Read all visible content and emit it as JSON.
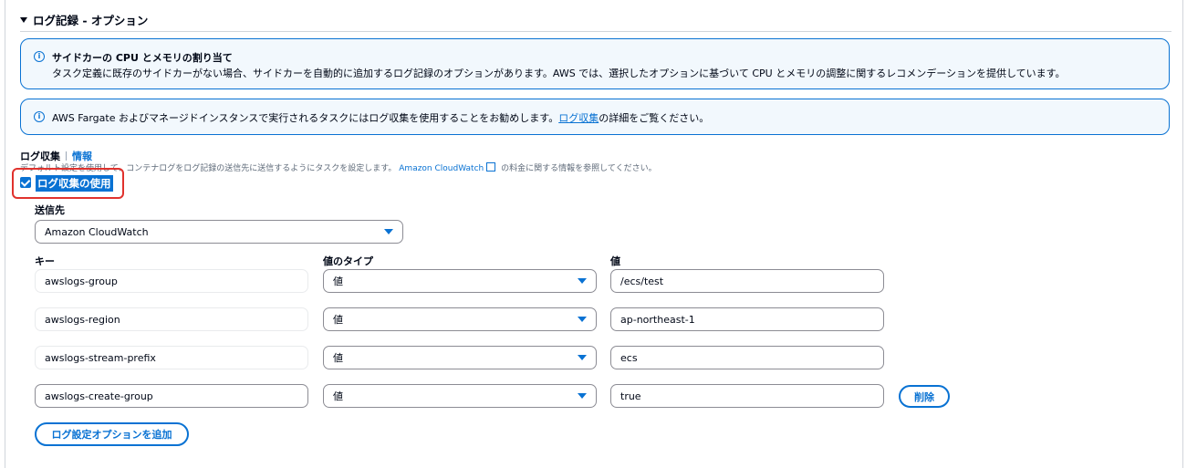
{
  "section": {
    "title": "ログ記録 - オプション"
  },
  "alert_sidecar": {
    "title": "サイドカーの CPU とメモリの割り当て",
    "body": "タスク定義に既存のサイドカーがない場合、サイドカーを自動的に追加するログ記録のオプションがあります。AWS では、選択したオプションに基づいて CPU とメモリの調整に関するレコメンデーションを提供しています。"
  },
  "alert_fargate": {
    "body_before": "AWS Fargate およびマネージドインスタンスで実行されるタスクにはログ収集を使用することをお勧めします。",
    "link": "ログ収集",
    "body_after": "の詳細をご覧ください。"
  },
  "log_collection": {
    "label": "ログ収集",
    "info": "情報",
    "desc_before": "デフォルト設定を使用して、コンテナログをログ記録の送信先に送信するようにタスクを設定します。",
    "desc_link": "Amazon CloudWatch",
    "desc_after": "の料金に関する情報を参照してください。",
    "checkbox_label": "ログ収集の使用",
    "checkbox_checked": true
  },
  "destination": {
    "label": "送信先",
    "value": "Amazon CloudWatch"
  },
  "columns": {
    "key": "キー",
    "value_type": "値のタイプ",
    "value": "値"
  },
  "options": [
    {
      "key": "awslogs-group",
      "type": "値",
      "value": "/ecs/test"
    },
    {
      "key": "awslogs-region",
      "type": "値",
      "value": "ap-northeast-1"
    },
    {
      "key": "awslogs-stream-prefix",
      "type": "値",
      "value": "ecs"
    },
    {
      "key": "awslogs-create-group",
      "type": "値",
      "value": "true"
    }
  ],
  "buttons": {
    "delete": "削除",
    "add_option": "ログ設定オプションを追加"
  },
  "colors": {
    "accent": "#0972d3",
    "highlight": "#e0322d",
    "alert_bg": "#f2f8fd"
  }
}
